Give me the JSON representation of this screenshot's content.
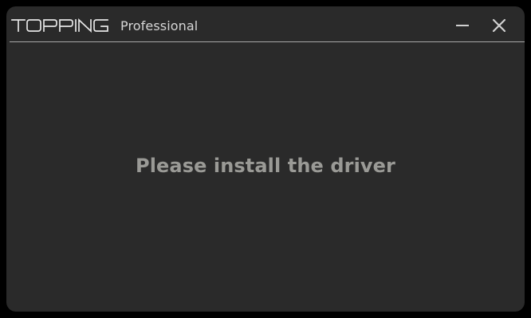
{
  "window": {
    "brand": "TOPPING",
    "subtitle": "Professional",
    "message": "Please install the driver"
  },
  "controls": {
    "minimize_icon": "minimize-icon",
    "close_icon": "close-icon"
  },
  "colors": {
    "background": "#2a2a2a",
    "outer": "#000000",
    "text_light": "#d6d6d6",
    "message_text": "#9a9a96",
    "divider": "#a8a8a8"
  }
}
